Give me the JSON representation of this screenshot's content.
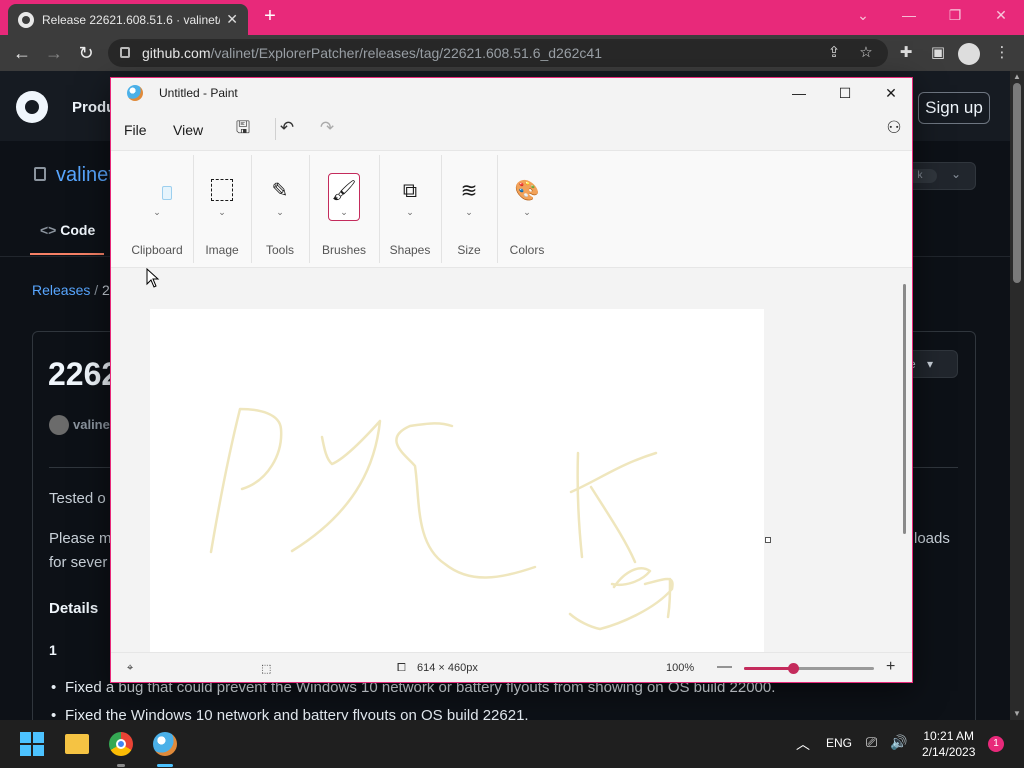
{
  "browser": {
    "tab_title": "Release 22621.608.51.6 · valinet/",
    "url_domain": "github.com",
    "url_path": "/valinet/ExplorerPatcher/releases/tag/22621.608.51.6_d262c41",
    "accent_color": "#e8297a"
  },
  "github": {
    "product_label": "Produ",
    "sign_up": "Sign up",
    "repo_fragment": "valinet",
    "fork_fragment": "k",
    "code_tab": "Code",
    "breadcrumb_releases": "Releases",
    "breadcrumb_sep": "/",
    "breadcrumb_rest": "22",
    "release_title_fragment": "2262",
    "more_button_fragment": "re",
    "user_fragment": "valine",
    "tested_fragment": "Tested o",
    "please_fragment": "Please m",
    "loads_fragment": "loads",
    "for_sever_fragment": "for sever",
    "details_heading": "Details",
    "list_number": "1",
    "bullets": [
      "Fixed a bug that could prevent the Windows 10 network or battery flyouts from showing on OS build 22000.",
      "Fixed the Windows 10 network and battery flyouts on OS build 22621."
    ]
  },
  "paint": {
    "title": "Untitled - Paint",
    "menu": {
      "file": "File",
      "view": "View"
    },
    "ribbon_groups": [
      {
        "label": "Clipboard"
      },
      {
        "label": "Image"
      },
      {
        "label": "Tools"
      },
      {
        "label": "Brushes"
      },
      {
        "label": "Shapes"
      },
      {
        "label": "Size"
      },
      {
        "label": "Colors"
      }
    ],
    "canvas_size": "614 × 460px",
    "zoom": "100%",
    "zoom_fraction": 0.38,
    "stroke_color": "#efe6bd"
  },
  "taskbar": {
    "language": "ENG",
    "time": "10:21 AM",
    "date": "2/14/2023",
    "notification_count": "1"
  }
}
